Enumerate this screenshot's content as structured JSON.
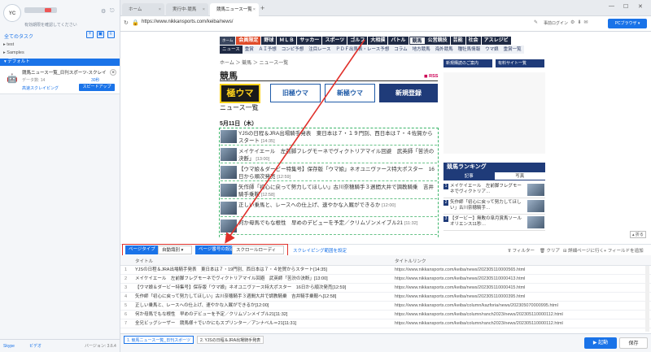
{
  "app": {
    "logo_text": "YOU\nCANO",
    "user_sub": "有効期限を確認してください",
    "tasks_title": "全てのタスク",
    "tree": [
      "test",
      "Samples"
    ],
    "group": "デフォルト",
    "task": {
      "title": "競馬ニュース一覧_日刊スポーツ-スクレイ…",
      "count_label": "データ数: 14",
      "time": "30秒",
      "mode": "高速スクレイピング",
      "speed_button": "スピードアップ"
    },
    "footer": {
      "help": "Skype",
      "video": "ビデオ",
      "version": "バージョン: 3.6.4"
    }
  },
  "browser": {
    "tabs": [
      {
        "label": "ホーム"
      },
      {
        "label": "実行中-競馬"
      },
      {
        "label": "競馬ニュース一覧"
      }
    ],
    "url": "https://www.nikkansports.com/keiba/news/",
    "pre_login": "事前ログイン",
    "pc_browser": "PCブラウザ"
  },
  "site": {
    "nav1": [
      "ホーム",
      "会員限定",
      "野球",
      "ＭＬＢ",
      "サッカー",
      "スポーツ",
      "ゴルフ",
      "大相撲",
      "バトル",
      "競馬",
      "公営競技",
      "芸能",
      "社会",
      "アスレジビ"
    ],
    "nav2": [
      "ニュース",
      "重賞",
      "ＡＩ予想",
      "コンピ予想",
      "注目レース",
      "ＰＤＦ出馬表・レース予想",
      "コラム",
      "地方競馬",
      "海外競馬",
      "種牡馬情報",
      "ウマ娘",
      "重賞一覧"
    ],
    "breadcrumb": "ホーム ＞ 競馬 ＞ ニュース一覧",
    "heading": "競馬",
    "rss": "RSS",
    "banner_logo": "極ウマ",
    "banner_sub": "ニュース一覧",
    "banner_buttons": [
      "旧極ウマ",
      "新極ウマ",
      "新規登録"
    ],
    "date": "5月11日（木）",
    "articles": [
      {
        "text": "YJSの日程＆JRA出場騎手発表　東日本は７・１９門別、西日本は７・４佐賀からスタート",
        "time": "[14:35]"
      },
      {
        "text": "メイケイエール　左前脚フレグモーネでヴィクトリアマイル回避　武英師「苦渋の決断」",
        "time": "[13:00]"
      },
      {
        "text": "【ウマ娘＆ダービー特集号】保存版「ウマ娘」ネオユニヴァース特大ポスター　16日から順次発売",
        "time": "[12:59]"
      },
      {
        "text": "矢作師「初心に戻って努力してほしい」古川奈穂騎手３週間大井で調教騎乗　吉井騎手乗鞍",
        "time": "[12:58]"
      },
      {
        "text": "正しい乗馬と、レースへの仕上げ、速やかな入厩ができるか",
        "time": "[12:00]"
      },
      {
        "text": "何か母馬でもな根性　早めのデビューを予定／クリムゾンメイブル21",
        "time": "[11:32]"
      }
    ],
    "right_buttons": [
      "新規購読のご案内",
      "有料サイト一覧"
    ],
    "ranking_title": "競馬ランキング",
    "ranking_tabs": [
      "記事",
      "写真"
    ],
    "ranking": [
      {
        "no": "1",
        "text": "メイケイエール　左前脚フレグモーネでヴィクトリア…"
      },
      {
        "no": "2",
        "text": "矢作師「初心に戻って努力してほしい」古川奈穂騎手…"
      },
      {
        "no": "3",
        "text": "【ダービー】無敗の皐月賞馬ソールオリエンス11秒…"
      }
    ],
    "fold": "折る"
  },
  "toolbar": {
    "type_button": "ページタイプ",
    "auto_detect": "自動識別",
    "page_no_button": "ページ番号の設定",
    "scroll_load": "スクロールローディン",
    "scroll_setting": "スクレイピング範囲を設定",
    "filter": "フィルター",
    "clear": "クリア",
    "detail": "詳細ページに行く",
    "add_field": "フィールドを追加"
  },
  "table": {
    "columns": [
      "タイトル",
      "タイトルリンク"
    ],
    "rows": [
      {
        "n": "1",
        "title": "YJSの日程＆JRA出場騎手発表　東日本は７・19門別、西日本は７・４佐賀からスタート[14:35]",
        "link": "https://www.nikkansports.com/keiba/news/202305110000565.html"
      },
      {
        "n": "2",
        "title": "メイケイエール　左前脚フレグモーネでヴィクトリアマイル回避　武英師「苦渋の決断」[13:00]",
        "link": "https://www.nikkansports.com/keiba/news/202305110000413.html"
      },
      {
        "n": "3",
        "title": "【ウマ娘＆ダービー特集号】保存版「ウマ娘」ネオユニヴァース特大ポスター　16日から順次発売[12:59]",
        "link": "https://www.nikkansports.com/keiba/news/202305110000415.html"
      },
      {
        "n": "4",
        "title": "矢作師「初心に戻って努力してほしい」古川奈穂騎手３週間大井で調教騎乗　吉井騎手乗鞍へ[12:58]",
        "link": "https://www.nikkansports.com/keiba/news/202305110000395.html"
      },
      {
        "n": "5",
        "title": "正しい乗馬と、レースへの仕上げ、速やかな入厩ができるか[12:00]",
        "link": "https://www.nikkansports.com/keiba/column/kazforia/news/202305070000995.html"
      },
      {
        "n": "6",
        "title": "何か母馬でもな根性　早めのデビューを予定／クリムゾンメイブル21[11:32]",
        "link": "https://www.nikkansports.com/keiba/column/ranch2023/news/202305110000112.html"
      },
      {
        "n": "7",
        "title": "全兄ビッグシーザー　競馬様＋でいかにもスプリンター／アンナベル＝21[11:31]",
        "link": "https://www.nikkansports.com/keiba/column/ranch2023/news/202305110000112.html"
      }
    ]
  },
  "bottom": {
    "tabs": [
      "1. 競馬ニュース一覧_日刊スポーツ",
      "2. YJSの日程＆JRA出場騎手発表"
    ],
    "run": "▶ 起動",
    "save": "保存"
  },
  "colors": {
    "accent": "#1a73e8",
    "highlight": "#e0302a",
    "site_nav": "#1f2a44"
  }
}
